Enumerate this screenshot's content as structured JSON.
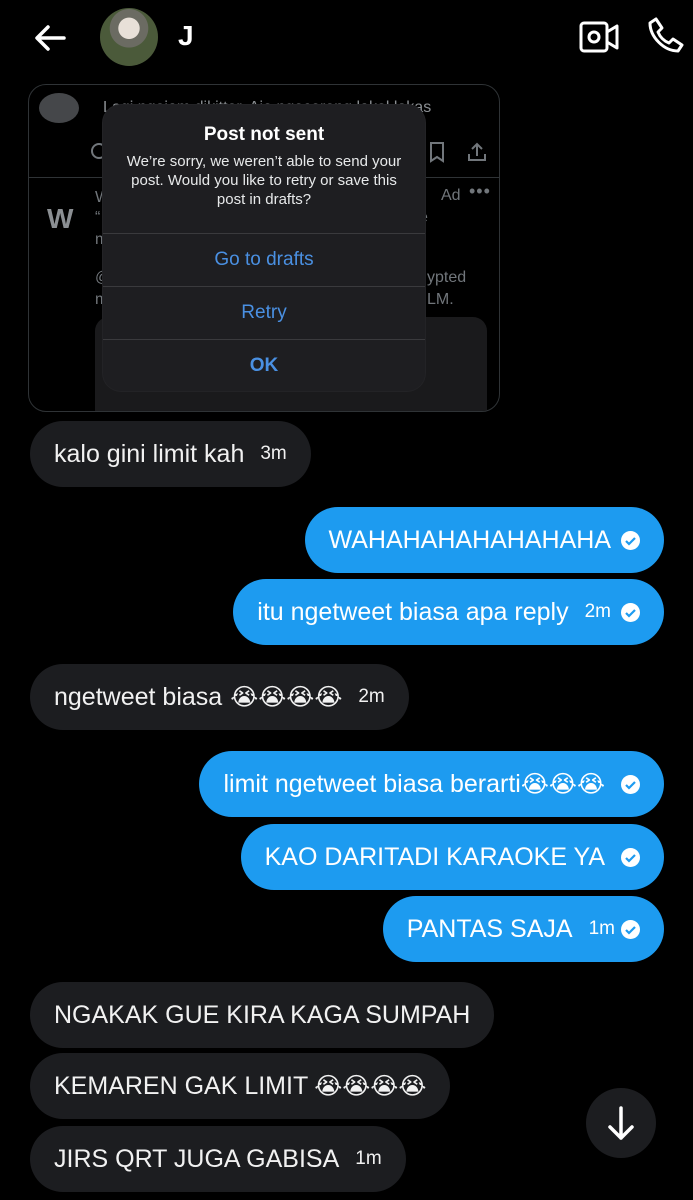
{
  "header": {
    "contact_name": "J"
  },
  "shared_post": {
    "text_top": "Lagi ngejam dikitter. Aje ngecereng lakol lakas",
    "ad_label": "Ad",
    "frag_a": "W",
    "frag_b": "“",
    "frag_c": "m",
    "frag_d": "@",
    "frag_e": "ypted",
    "frag_f": "m",
    "frag_g": "LM.",
    "frag_h": "e",
    "logo_letter": "W"
  },
  "modal": {
    "title": "Post not sent",
    "message": "We’re sorry, we weren’t able to send your post. Would you like to retry or save this post in drafts?",
    "go_to_drafts": "Go to drafts",
    "retry": "Retry",
    "ok": "OK"
  },
  "messages": [
    {
      "side": "in",
      "text": "kalo gini limit kah",
      "time": "3m"
    },
    {
      "side": "out",
      "text": "WAHAHAHAHAHAHAHA"
    },
    {
      "side": "out",
      "text": "itu ngetweet biasa apa reply",
      "time": "2m"
    },
    {
      "side": "in",
      "text": "ngetweet biasa",
      "emoji": "😭😭😭😭",
      "time": "2m"
    },
    {
      "side": "out",
      "text": "limit ngetweet biasa berarti",
      "emoji": "😭😭😭"
    },
    {
      "side": "out",
      "text": "KAO DARITADI KARAOKE YA"
    },
    {
      "side": "out",
      "text": "PANTAS SAJA",
      "time": "1m"
    },
    {
      "side": "in",
      "text": "NGAKAK GUE KIRA KAGA SUMPAH"
    },
    {
      "side": "in",
      "text": "KEMAREN GAK LIMIT",
      "emoji": "😭😭😭😭"
    },
    {
      "side": "in",
      "text": "JIRS QRT JUGA GABISA",
      "time": "1m"
    }
  ]
}
